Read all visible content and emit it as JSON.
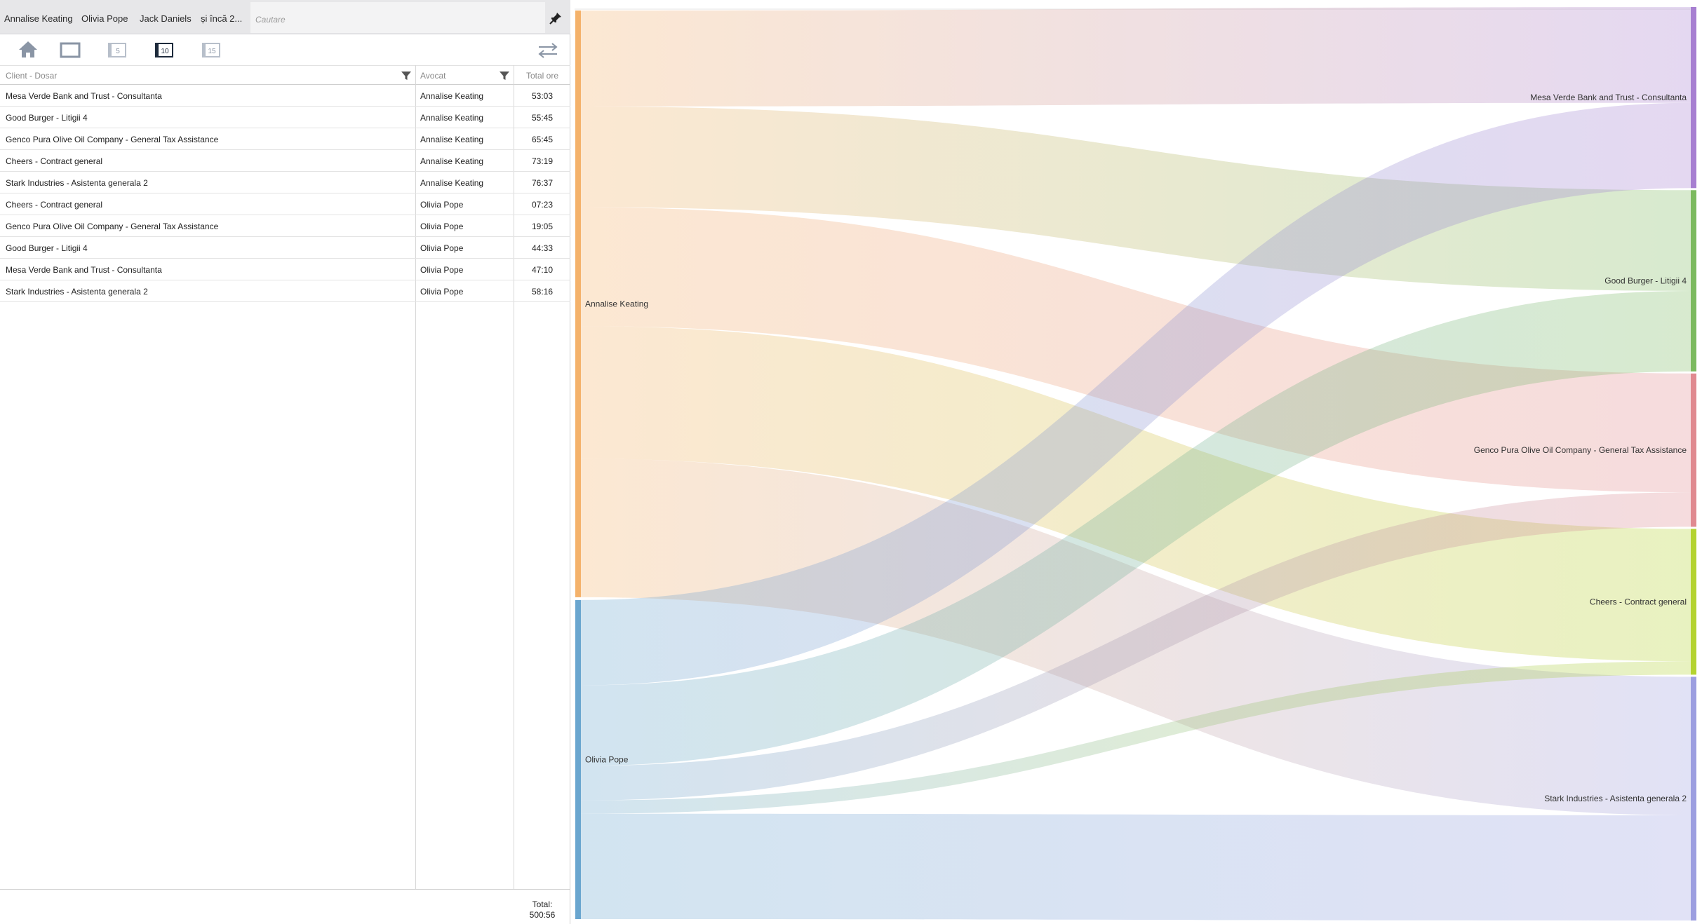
{
  "topbar": {
    "chips": [
      "Annalise Keating",
      "Olivia Pope",
      "Jack Daniels",
      "și încă 2..."
    ],
    "search_placeholder": "Cautare"
  },
  "toolbar": {
    "icons": [
      "home-icon",
      "single-view-icon",
      "top-5-icon",
      "top-10-icon",
      "top-15-icon",
      "swap-icon"
    ],
    "labels": {
      "top5": "5",
      "top10": "10",
      "top15": "15"
    },
    "active": "top-10"
  },
  "grid": {
    "headers": {
      "client": "Client - Dosar",
      "lawyer": "Avocat",
      "hours": "Total ore"
    },
    "rows": [
      {
        "client": "Mesa Verde Bank and Trust - Consultanta",
        "lawyer": "Annalise Keating",
        "hours": "53:03"
      },
      {
        "client": "Good Burger - Litigii 4",
        "lawyer": "Annalise Keating",
        "hours": "55:45"
      },
      {
        "client": "Genco Pura Olive Oil Company - General Tax Assistance",
        "lawyer": "Annalise Keating",
        "hours": "65:45"
      },
      {
        "client": "Cheers - Contract general",
        "lawyer": "Annalise Keating",
        "hours": "73:19"
      },
      {
        "client": "Stark Industries - Asistenta generala 2",
        "lawyer": "Annalise Keating",
        "hours": "76:37"
      },
      {
        "client": "Cheers - Contract general",
        "lawyer": "Olivia Pope",
        "hours": "07:23"
      },
      {
        "client": "Genco Pura Olive Oil Company - General Tax Assistance",
        "lawyer": "Olivia Pope",
        "hours": "19:05"
      },
      {
        "client": "Good Burger - Litigii 4",
        "lawyer": "Olivia Pope",
        "hours": "44:33"
      },
      {
        "client": "Mesa Verde Bank and Trust - Consultanta",
        "lawyer": "Olivia Pope",
        "hours": "47:10"
      },
      {
        "client": "Stark Industries - Asistenta generala 2",
        "lawyer": "Olivia Pope",
        "hours": "58:16"
      }
    ],
    "footer": {
      "total_label": "Total:",
      "total_value": "500:56"
    }
  },
  "sankey": {
    "sources": [
      {
        "name": "Annalise Keating",
        "color": "#f4b26b"
      },
      {
        "name": "Olivia Pope",
        "color": "#6aa6cf"
      }
    ],
    "targets": [
      {
        "name": "Mesa Verde Bank and Trust - Consultanta",
        "color": "#a77fd1"
      },
      {
        "name": "Good Burger - Litigii 4",
        "color": "#7cba5f"
      },
      {
        "name": "Genco Pura Olive Oil Company - General Tax Assistance",
        "color": "#e08a90"
      },
      {
        "name": "Cheers - Contract general",
        "color": "#b4d330"
      },
      {
        "name": "Stark Industries - Asistenta generala 2",
        "color": "#9c9ee0"
      }
    ],
    "links": [
      {
        "source": "Annalise Keating",
        "target": "Mesa Verde Bank and Trust - Consultanta",
        "hours": 53.05
      },
      {
        "source": "Annalise Keating",
        "target": "Good Burger - Litigii 4",
        "hours": 55.75
      },
      {
        "source": "Annalise Keating",
        "target": "Genco Pura Olive Oil Company - General Tax Assistance",
        "hours": 65.75
      },
      {
        "source": "Annalise Keating",
        "target": "Cheers - Contract general",
        "hours": 73.317
      },
      {
        "source": "Annalise Keating",
        "target": "Stark Industries - Asistenta generala 2",
        "hours": 76.617
      },
      {
        "source": "Olivia Pope",
        "target": "Mesa Verde Bank and Trust - Consultanta",
        "hours": 47.167
      },
      {
        "source": "Olivia Pope",
        "target": "Good Burger - Litigii 4",
        "hours": 44.55
      },
      {
        "source": "Olivia Pope",
        "target": "Genco Pura Olive Oil Company - General Tax Assistance",
        "hours": 19.083
      },
      {
        "source": "Olivia Pope",
        "target": "Cheers - Contract general",
        "hours": 7.383
      },
      {
        "source": "Olivia Pope",
        "target": "Stark Industries - Asistenta generala 2",
        "hours": 58.267
      }
    ]
  }
}
